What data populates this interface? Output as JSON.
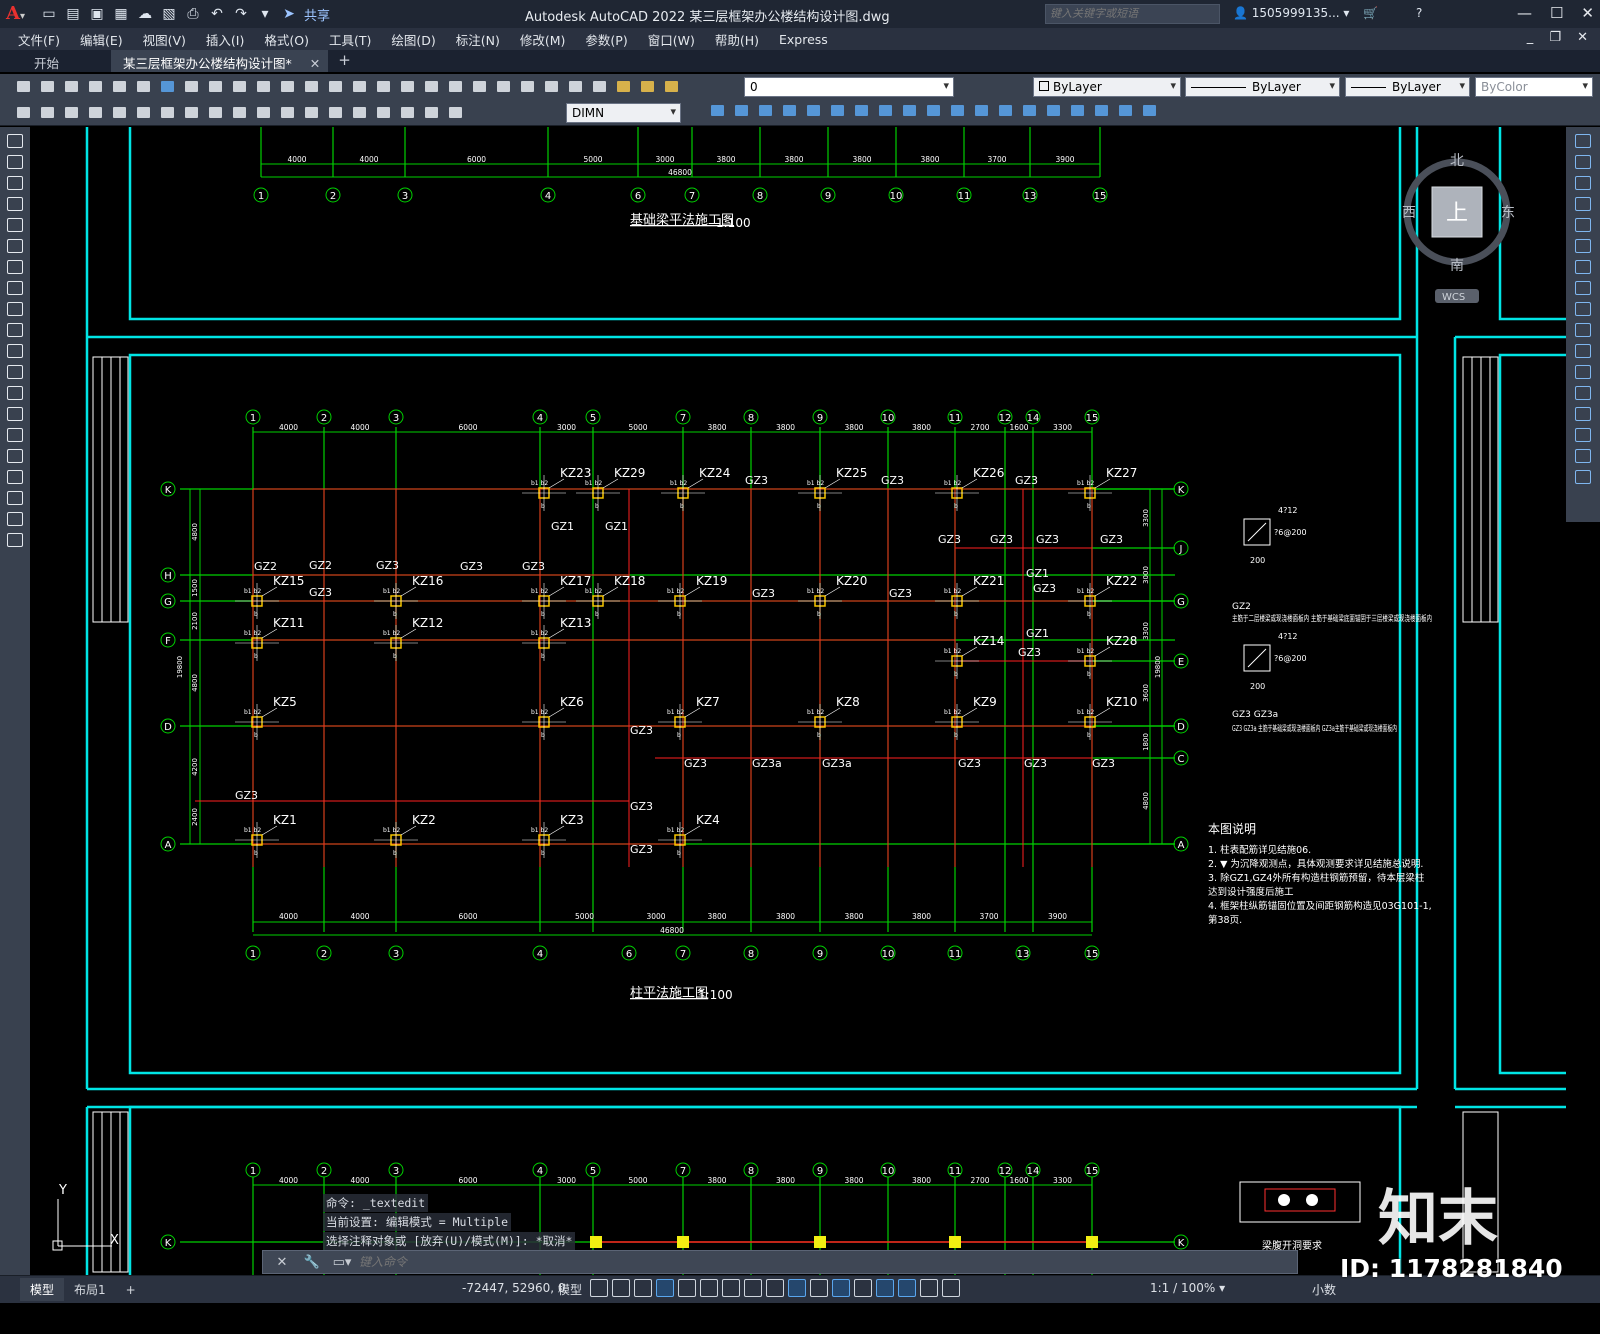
{
  "app": {
    "title": "Autodesk AutoCAD 2022    某三层框架办公楼结构设计图.dwg",
    "share": "共享",
    "search_placeholder": "键入关键字或短语",
    "user": "1505999135... ▾"
  },
  "menu": [
    "文件(F)",
    "编辑(E)",
    "视图(V)",
    "插入(I)",
    "格式(O)",
    "工具(T)",
    "绘图(D)",
    "标注(N)",
    "修改(M)",
    "参数(P)",
    "窗口(W)",
    "帮助(H)",
    "Express"
  ],
  "tabs": {
    "start": "开始",
    "active": "某三层框架办公楼结构设计图*",
    "close": "✕",
    "plus": "+"
  },
  "toolbar": {
    "layer": "0",
    "color": "ByLayer",
    "linetype": "ByLayer",
    "lineweight": "ByLayer",
    "plotstyle": "ByColor",
    "dimstyle": "DIMN"
  },
  "viewcube": {
    "north": "北",
    "south": "南",
    "east": "东",
    "west": "西",
    "top": "上",
    "wcs": "WCS"
  },
  "drawing": {
    "title_top": "基础梁平法施工图",
    "title_main": "柱平法施工图",
    "scale": "1:100",
    "total_width": "46800",
    "total_height": "19800",
    "col_axes": [
      "1",
      "2",
      "3",
      "4",
      "5",
      "6",
      "7",
      "8",
      "9",
      "10",
      "11",
      "12",
      "13",
      "14",
      "15"
    ],
    "row_axes": [
      "K",
      "J",
      "H",
      "G",
      "F",
      "E",
      "D",
      "C",
      "A"
    ],
    "dims_top": [
      "4000",
      "4000",
      "6000",
      "3000",
      "5000",
      "3800",
      "3800",
      "3800",
      "3800",
      "2700",
      "1600",
      "3300"
    ],
    "dims_bottom": [
      "4000",
      "4000",
      "6000",
      "5000",
      "3000",
      "3800",
      "3800",
      "3800",
      "3800",
      "3700",
      "3900"
    ],
    "dims_left": [
      "4800",
      "1500",
      "2100",
      "4800",
      "4200",
      "2400"
    ],
    "dims_right": [
      "3300",
      "3000",
      "3300",
      "3600",
      "1800",
      "4800"
    ],
    "columns": [
      "KZ1",
      "KZ2",
      "KZ3",
      "KZ4",
      "KZ5",
      "KZ6",
      "KZ7",
      "KZ8",
      "KZ9",
      "KZ10",
      "KZ11",
      "KZ12",
      "KZ13",
      "KZ14",
      "KZ15",
      "KZ16",
      "KZ17",
      "KZ18",
      "KZ19",
      "KZ20",
      "KZ21",
      "KZ22",
      "KZ23",
      "KZ24",
      "KZ25",
      "KZ26",
      "KZ27",
      "KZ28",
      "KZ29"
    ],
    "notes_title": "本图说明",
    "notes": [
      "1. 柱表配筋详见结施06.",
      "2. ▼ 为沉降观测点，具体观测要求详见结施总说明.",
      "3. 除GZ1,GZ4外所有构造柱钢筋预留，待本层梁柱",
      "   达到设计强度后施工",
      "4. 框架柱纵筋锚固位置及间距钢筋构造见03G101-1,",
      "   第38页."
    ],
    "gz2_note": "主筋于二层楼梁或现浇楼面板内 主筋于基础梁底面锚固于三层楼梁或现浇楼面板内",
    "gz3_note": "GZ3 GZ3a 主筋于基础梁或现浇楼面板内 GZ3a主筋于基础梁或现浇楼面板内",
    "section_rebar": "4?12",
    "section_stirrup": "?6@200",
    "section_size": "200",
    "opening_note": "梁腹开洞要求"
  },
  "command": {
    "history": [
      "命令: _textedit",
      "当前设置: 编辑模式 = Multiple",
      "选择注释对象或 [放弃(U)/模式(M)]: *取消*"
    ],
    "placeholder": "键入命令"
  },
  "status": {
    "model_tab": "模型",
    "layout_tab": "布局1",
    "plus": "+",
    "coords": "-72447, 52960, 0",
    "mode": "模型",
    "scale": "1:1 / 100% ▾",
    "units": "小数"
  },
  "watermark": {
    "id": "ID: 1178281840",
    "logo": "知末"
  }
}
